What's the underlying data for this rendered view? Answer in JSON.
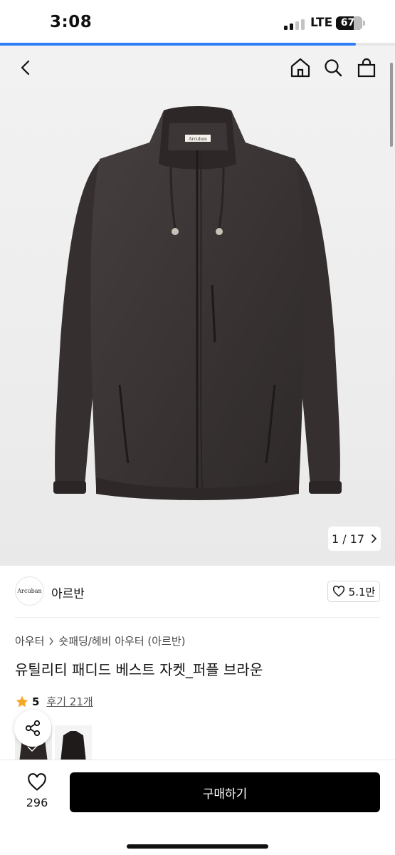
{
  "status_bar": {
    "time": "3:08",
    "network": "LTE",
    "battery": "67",
    "battery_level": 0.67,
    "signal_bars_active": 2,
    "signal_bars_total": 4
  },
  "page_progress": 0.9,
  "nav": {
    "back_icon": "chevron-left-icon",
    "home_icon": "home-icon",
    "search_icon": "search-icon",
    "cart_icon": "shopping-bag-icon"
  },
  "gallery": {
    "current": "1",
    "separator": "/",
    "total": "17",
    "counter_text": "1 / 17",
    "next_icon": "chevron-right-icon",
    "label_text": "Arcuban"
  },
  "brand": {
    "logo_text": "Arcuban",
    "name": "아르반",
    "likes": "5.1만"
  },
  "product": {
    "breadcrumb": [
      "아우터",
      "숏패딩/헤비 아우터 (아르반)"
    ],
    "title": "유틸리티 패디드 베스트 자켓_퍼플 브라운",
    "rating": "5",
    "review_link": "후기 21개"
  },
  "bottom_bar": {
    "wish_count": "296",
    "buy_label": "구매하기"
  },
  "colors": {
    "accent": "#2f7df6",
    "star": "#f5a623",
    "buy_button": "#000000",
    "jacket": "#3a3434"
  }
}
